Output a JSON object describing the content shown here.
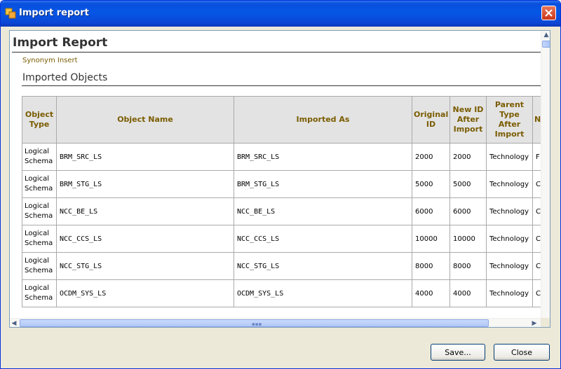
{
  "window": {
    "title": "Import report"
  },
  "report": {
    "title": "Import Report",
    "subtitle": "Synonym Insert",
    "section_title": "Imported Objects"
  },
  "table": {
    "headers": [
      "Object Type",
      "Object Name",
      "Imported As",
      "Original ID",
      "New ID After Import",
      "Parent Type After Import",
      "N"
    ],
    "rows": [
      [
        "Logical Schema",
        "BRM_SRC_LS",
        "BRM_SRC_LS",
        "2000",
        "2000",
        "Technology",
        "F"
      ],
      [
        "Logical Schema",
        "BRM_STG_LS",
        "BRM_STG_LS",
        "5000",
        "5000",
        "Technology",
        "C"
      ],
      [
        "Logical Schema",
        "NCC_BE_LS",
        "NCC_BE_LS",
        "6000",
        "6000",
        "Technology",
        "C"
      ],
      [
        "Logical Schema",
        "NCC_CCS_LS",
        "NCC_CCS_LS",
        "10000",
        "10000",
        "Technology",
        "C"
      ],
      [
        "Logical Schema",
        "NCC_STG_LS",
        "NCC_STG_LS",
        "8000",
        "8000",
        "Technology",
        "C"
      ],
      [
        "Logical Schema",
        "OCDM_SYS_LS",
        "OCDM_SYS_LS",
        "4000",
        "4000",
        "Technology",
        "C"
      ]
    ]
  },
  "buttons": {
    "save": "Save...",
    "close": "Close"
  },
  "colors": {
    "title_bar": "#0A4FDD",
    "header_text": "#7A5C00",
    "window_bg": "#ECE9D8"
  }
}
